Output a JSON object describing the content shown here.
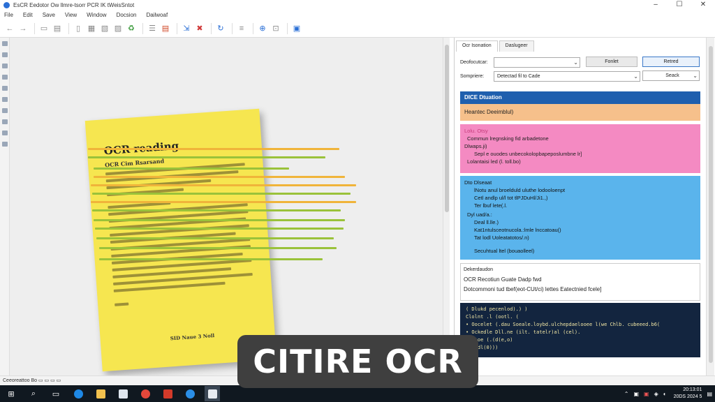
{
  "window": {
    "title": "EsCR Eedotor Ow llmre-tsorr PCR IK tWeisSntot",
    "controls": [
      "–",
      "☐",
      "✕"
    ]
  },
  "menu": [
    "File",
    "Edit",
    "Save",
    "View",
    "Window",
    "Docsion",
    "Dailwoaf"
  ],
  "document": {
    "title": "OCR reading",
    "subtitle": "OCR Cim Rsarsand",
    "footer": "SID Naue 3 Noll"
  },
  "side_panel": {
    "tabs": [
      "Ocr Isonation",
      "Daslugeer"
    ],
    "source_label": "Deofocutcar:",
    "source_value": "",
    "output_label": "Sompriere:",
    "output_value": "Detectad fil to Cade",
    "button_cancel": "Fonlet",
    "button_read": "Retred",
    "button_setup": "Seack",
    "results_header": "DICE Dtuation",
    "results_orange": "Heantec Deeimblul)",
    "results_pink": [
      "Lolu. Otsy",
      "Commun lregnsking fid arbadetone",
      "Dlwaps.ji)",
      "Sepl e ouodes unbecokolopbapeposlumbne lr]",
      "Lolantaisi led (l. toll.bo)"
    ],
    "results_blue": [
      "Dto Dlseaat",
      "lNotu anul broelduld uluthe lodooloenpt",
      "Cetl andlp ul/l tot tlPJDuHl/Ji1.,)",
      "Ter lbuf lete(.l.",
      "Dyl uad/a.:",
      "Deal ll.lle.)",
      "Kat1ntulsceotnucola.:lmle lnccatoau()",
      "Tat lodl Uoleatatotos/.n)",
      "Secuhtual ltel (bouaolleel)"
    ],
    "results_white": {
      "label": "Dekerdaudon",
      "line1": "OCR Recotiun Guate Dadp fwd",
      "line2": "Dotcommoni tud tbef(eot-CUt/ci) lettes Eatectnied fcele]"
    },
    "results_code": [
      "(         Dlukd pecenlod).)                                    )",
      "   Clolnt .l   (ootl.   (",
      "•  Oocelet (.dau Soeale.loybd.ulchepdaelooee l(we Chlb. cubeeed.b6(",
      "•  Ockedle Dll.ne  (ilt. tatelr)al (cel).",
      "   Rcb    oe (.(d(e,o)",
      ")   (.dl(0)))"
    ]
  },
  "statusbar": "Ceeoreattoo    Bo    ▭ ▭ ▭ ▭",
  "taskbar": {
    "clock_time": "20:13:01",
    "clock_date": "20DS 2024 5"
  },
  "banner": "CITIRE OCR"
}
